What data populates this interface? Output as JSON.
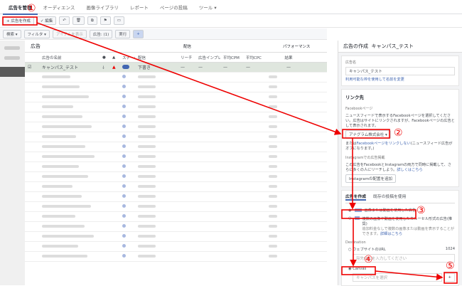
{
  "nav": {
    "tabs": [
      "広告を管理",
      "オーディエンス",
      "画像ライブラリ",
      "レポート",
      "ページの投稿",
      "ツール ▾"
    ]
  },
  "toolbar": {
    "create": "+ 広告を作成",
    "edit": "✓ 編集"
  },
  "filterbar": {
    "search": "検索 ▾",
    "filter": "フィルタ ▾",
    "show_items": "アイテムを表示",
    "ads_count": "広告: (1)",
    "run": "実行",
    "plus": "+"
  },
  "table": {
    "title": "広告",
    "group_delivery": "配信",
    "group_performance": "パフォーマンス",
    "columns": [
      "広告の名前",
      "●",
      "▲",
      "ステータス",
      "配信",
      "リーチ",
      "広告インプレ",
      "平均CPM",
      "平均CPC",
      "結果"
    ],
    "row": {
      "name": "キャンパス_テスト",
      "delivery": "下書き",
      "dash": "—"
    }
  },
  "panel": {
    "title": "広告の作成",
    "title_name": "キャンパス_テスト",
    "ad_name_label": "広告名",
    "ad_name": "キャンパス_テスト",
    "ad_name_link": "利用可能な枠を使用して名前を変更",
    "link_section": "リンク先",
    "fb_page_label": "Facebookページ",
    "fb_page_desc": "ニュースフィードで表示するFacebookページを選択してください。広告はサイトにリンクされますが、Facebookページの広告として表示されます。",
    "page_select": "アナグラム株式会社 ▾",
    "no_link_pre": "または",
    "no_link": "Facebookページをリンクしない",
    "no_link_post": "(ニュースフィード広告がオフになります。)",
    "ig_label": "Instagramでの広告掲載",
    "ig_desc": "この広告をFacebookとInstagramの両方で同時に掲載して、さらに多くの人にリーチしよう。",
    "ig_more": "詳しくはこちら",
    "ig_button": "Instagramの配置を追加",
    "tab_create": "広告を作成",
    "tab_existing": "既存の投稿を使用",
    "format1": "画像または動画を使用した広告",
    "format2": "複数の画像や動画を使用したカルーセル形式の広告(推奨)",
    "format2_desc": "追加料金なしで複数の画像または動画を表示することができます。",
    "format2_more": "詳細はこちら",
    "destination": "Destination",
    "website": "ウェブサイトのURL",
    "count": "1024",
    "url_placeholder": "宛先URLを入力してください",
    "canvas": "Canvas",
    "canvas_placeholder": "キャンパスを選択",
    "add": "+"
  },
  "annotations": [
    "①",
    "②",
    "③",
    "④",
    "⑤"
  ]
}
